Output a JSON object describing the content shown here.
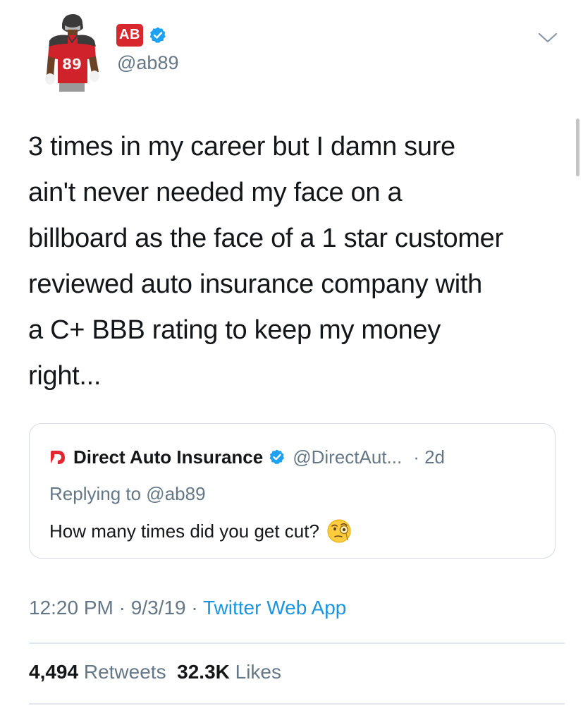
{
  "author": {
    "display_name": "AB",
    "handle": "@ab89",
    "jersey_number": "89",
    "avatar_icon": "player-avatar-icon",
    "verified": true,
    "brand_color": "#d9272e"
  },
  "tweet": {
    "text": "3 times in my career but I damn sure\nain't never needed my face on a\nbillboard as the face of a 1 star customer\nreviewed auto insurance company with\na C+ BBB rating to keep my money\nright..."
  },
  "quoted_tweet": {
    "name": "Direct Auto Insurance",
    "handle": "@DirectAut...",
    "time": "· 2d",
    "replying_to": "Replying to @ab89",
    "text": "How many times did you get cut?",
    "emoji_icon": "face-with-monocle-icon",
    "logo_icon": "direct-auto-logo-icon",
    "verified": true
  },
  "meta": {
    "time": "12:20 PM",
    "sep1": " · ",
    "date": "9/3/19",
    "sep2": " · ",
    "app": "Twitter Web App"
  },
  "stats": {
    "retweets_count": "4,494",
    "retweets_label": "Retweets",
    "likes_count": "32.3K",
    "likes_label": "Likes"
  },
  "colors": {
    "text": "#14171a",
    "secondary": "#657786",
    "link": "#1b95e0",
    "verified": "#1da1f2",
    "border": "#d8dde2"
  }
}
